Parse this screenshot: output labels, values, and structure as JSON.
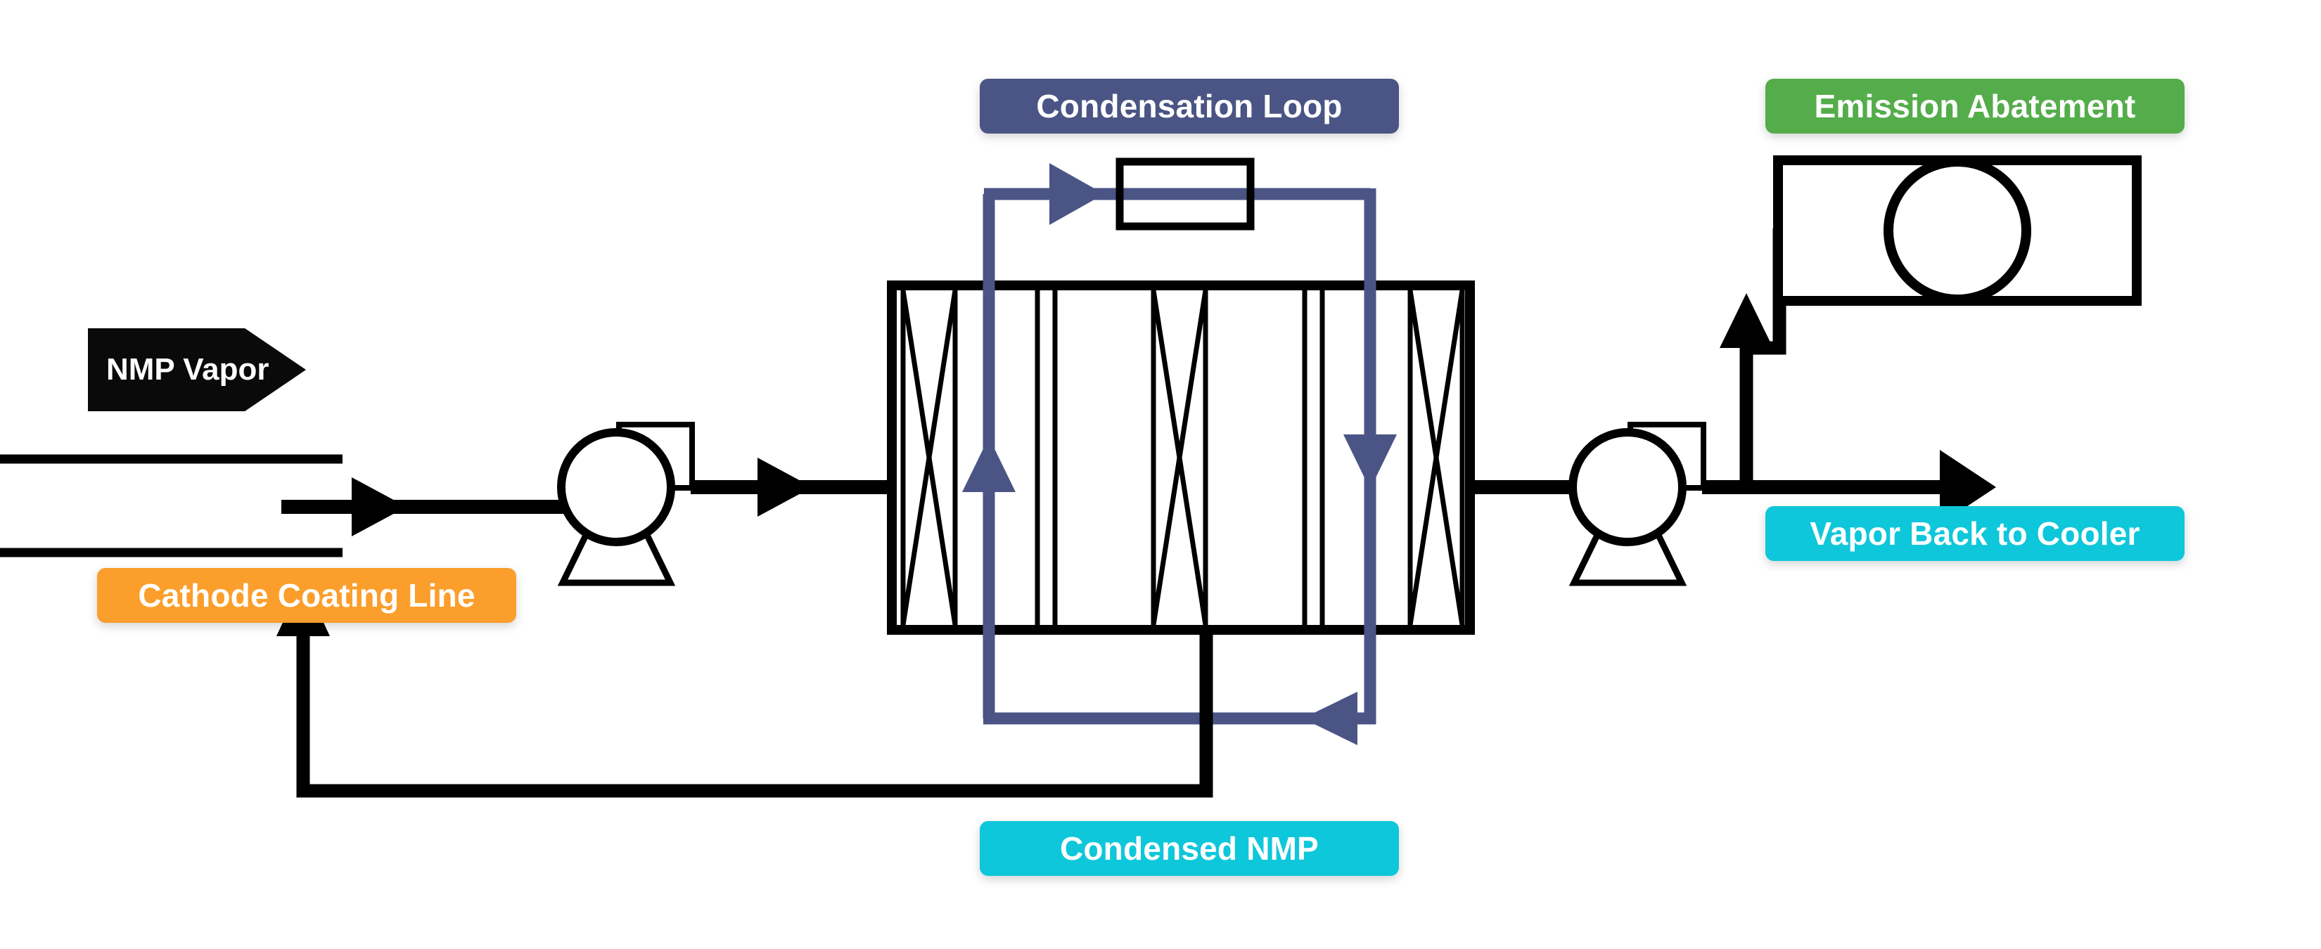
{
  "diagram": {
    "title": "NMP Vapor Recovery Process Flow",
    "background": "#ffffff"
  },
  "colors": {
    "process_line": "#000000",
    "coolant_loop": "#4a5585",
    "label_loop": "#4a5585",
    "label_abatement": "#54ad4a",
    "label_cyan": "#0ec7da",
    "label_orange": "#fb9e2b",
    "label_source": "#0a0a0a",
    "label_text": "#ffffff"
  },
  "labels": {
    "source_stream": "NMP Vapor",
    "condensation_loop": "Condensation Loop",
    "emission_abatement": "Emission Abatement",
    "vapor_back_to_cooler": "Vapor Back to Cooler",
    "cathode_coating_line": "Cathode Coating Line",
    "condensed_nmp": "Condensed NMP"
  },
  "equipment": [
    {
      "id": "coating-duct",
      "name": "Cathode Coating Line Duct",
      "symbol": "parallel-duct"
    },
    {
      "id": "inlet-blower",
      "name": "Inlet Blower",
      "symbol": "centrifugal-fan"
    },
    {
      "id": "heat-exchanger",
      "name": "Condenser Heat Exchanger",
      "symbol": "shell-and-tube"
    },
    {
      "id": "chiller-unit",
      "name": "Chiller / Coolant Conditioner",
      "symbol": "rectangle"
    },
    {
      "id": "outlet-blower",
      "name": "Outlet Blower",
      "symbol": "centrifugal-fan"
    },
    {
      "id": "abatement-unit",
      "name": "Emission Abatement Unit",
      "symbol": "vessel-with-drum"
    }
  ],
  "streams": [
    {
      "id": "vapor-in",
      "name": "NMP laden vapor to blower",
      "color": "#000000",
      "direction": "right"
    },
    {
      "id": "blower-to-hx",
      "name": "Vapor to heat exchanger",
      "color": "#000000",
      "direction": "right"
    },
    {
      "id": "hx-to-blower2",
      "name": "Treated vapor to blower",
      "color": "#000000",
      "direction": "right"
    },
    {
      "id": "vapor-recycle",
      "name": "Vapor back to cooler",
      "color": "#000000",
      "direction": "right"
    },
    {
      "id": "vapor-abatement",
      "name": "Vapor to abatement",
      "color": "#000000",
      "direction": "up"
    },
    {
      "id": "condensate",
      "name": "Condensed NMP return",
      "color": "#000000",
      "direction": "up"
    },
    {
      "id": "coolant-supply",
      "name": "Coolant supply (loop up)",
      "color": "#4a5585",
      "direction": "up"
    },
    {
      "id": "coolant-top",
      "name": "Coolant through chiller",
      "color": "#4a5585",
      "direction": "right"
    },
    {
      "id": "coolant-return",
      "name": "Coolant return (loop down)",
      "color": "#4a5585",
      "direction": "down"
    },
    {
      "id": "coolant-bottom",
      "name": "Coolant bottom header",
      "color": "#4a5585",
      "direction": "left"
    }
  ]
}
